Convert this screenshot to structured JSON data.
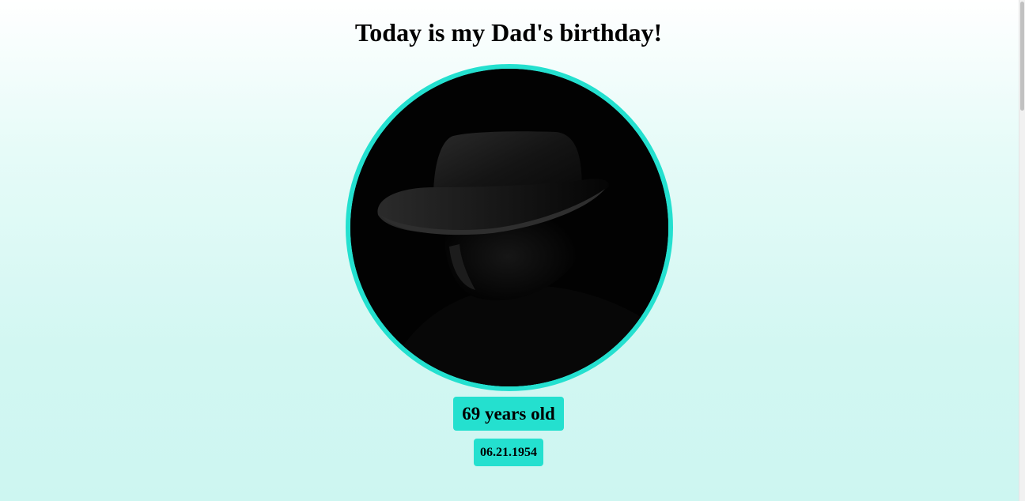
{
  "heading": "Today is my Dad's birthday!",
  "photo": {
    "icon": "portrait-silhouette-icon",
    "accent_color": "#24e0cf"
  },
  "age": "69 years old",
  "birth_date": "06.21.1954",
  "colors": {
    "accent": "#24e0cf",
    "background_top": "#ffffff",
    "background_bottom": "#cdf6f1"
  }
}
